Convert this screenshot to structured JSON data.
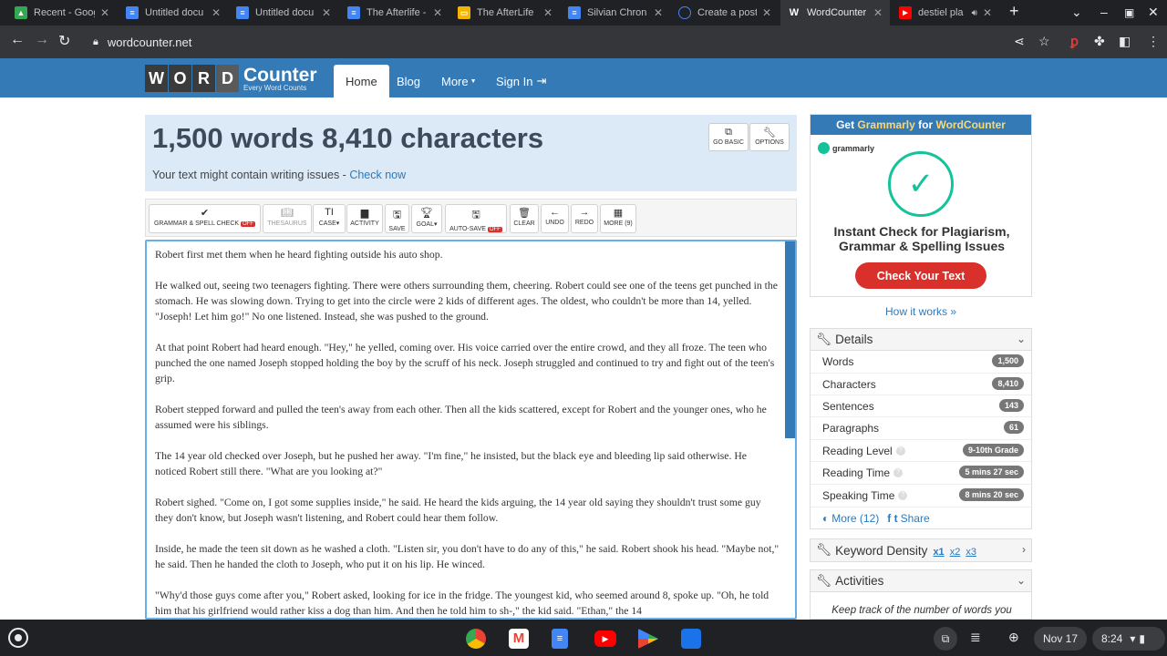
{
  "browser": {
    "tabs": [
      {
        "title": "Recent - Google",
        "icon": "google-drive-icon",
        "color": "#34a853",
        "active": false
      },
      {
        "title": "Untitled docu",
        "icon": "google-docs-icon",
        "color": "#4285f4",
        "active": false
      },
      {
        "title": "Untitled docu",
        "icon": "google-docs-icon",
        "color": "#4285f4",
        "active": false
      },
      {
        "title": "The Afterlife -",
        "icon": "google-docs-icon",
        "color": "#4285f4",
        "active": false
      },
      {
        "title": "The AfterLife",
        "icon": "google-slides-icon",
        "color": "#f4b400",
        "active": false
      },
      {
        "title": "Silvian Chron",
        "icon": "google-docs-icon",
        "color": "#4285f4",
        "active": false
      },
      {
        "title": "Create a post",
        "icon": "blogger-icon",
        "color": "#4285f4",
        "active": false
      },
      {
        "title": "WordCounter",
        "icon": "wordcounter-icon",
        "color": "#35363a",
        "active": true
      },
      {
        "title": "destiel pla",
        "icon": "youtube-icon",
        "color": "#ff0000",
        "active": false
      }
    ],
    "url": "wordcounter.net"
  },
  "site": {
    "logo_letters": [
      "W",
      "O",
      "R",
      "D"
    ],
    "logo_counter": "Counter",
    "logo_tagline": "Every Word Counts",
    "nav": {
      "home": "Home",
      "blog": "Blog",
      "more": "More",
      "signin": "Sign In"
    }
  },
  "main": {
    "word_summary": "1,500 words 8,410 characters",
    "issues_text": "Your text might contain writing issues - ",
    "issues_link": "Check now",
    "go_basic": "GO BASIC",
    "options": "OPTIONS"
  },
  "toolbar": {
    "grammar": "GRAMMAR & SPELL CHECK",
    "off_label": "OFF",
    "thesaurus": "THESAURUS",
    "case": "CASE",
    "activity": "ACTIVITY",
    "save": "SAVE",
    "goal": "GOAL",
    "autosave": "AUTO-SAVE",
    "clear": "CLEAR",
    "undo": "UNDO",
    "redo": "REDO",
    "more": "MORE (9)"
  },
  "editor": {
    "paragraphs": [
      "Robert first met them when he heard fighting outside his auto shop.",
      "He walked out, seeing two teenagers fighting. There were others surrounding them, cheering. Robert could see one of the teens get punched in the stomach. He was slowing down. Trying to get into the circle were 2 kids of different ages. The oldest, who couldn't be more than 14, yelled. \"Joseph! Let him go!\" No one listened. Instead, she was pushed to the ground.",
      "At that point Robert had heard enough. \"Hey,\" he yelled, coming over. His voice carried over the entire crowd, and they all froze. The teen who punched the one named Joseph stopped holding the boy by the scruff of his neck. Joseph struggled and continued to try and fight out of the teen's grip.",
      "Robert stepped forward and pulled the teen's away from each other. Then all the kids scattered, except for Robert and the younger ones, who he assumed were his siblings.",
      "The 14 year old checked over Joseph, but he pushed her away. \"I'm fine,\" he insisted, but the black eye and bleeding lip said otherwise. He noticed Robert still there. \"What are you looking at?\"",
      "Robert sighed. \"Come on, I got some supplies inside,\" he said. He heard the kids arguing, the 14 year old saying they shouldn't trust some guy they don't know, but Joseph wasn't listening, and Robert could hear them follow.",
      "Inside, he made the teen sit down as he washed a cloth. \"Listen sir, you don't have to do any of this,\" he said. Robert shook his head. \"Maybe not,\" he said. Then he handed the cloth to Joseph, who put it on his lip. He winced.",
      "\"Why'd those guys come after you,\" Robert asked, looking for ice in the fridge. The youngest kid, who seemed around 8, spoke up. \"Oh, he told him that his girlfriend would rather kiss a dog than him. And then he told him to sh-,\" the kid said. \"Ethan,\" the 14"
    ]
  },
  "sidebar": {
    "ad_header_prefix": "Get ",
    "ad_header_brand": "Grammarly",
    "ad_header_mid": " for ",
    "ad_header_site": "WordCounter",
    "ad_brand": "grammarly",
    "ad_title": "Instant Check for Plagiarism, Grammar & Spelling Issues",
    "ad_button": "Check Your Text",
    "how_it_works": "How it works »",
    "details_title": "Details",
    "details": [
      {
        "label": "Words",
        "value": "1,500",
        "help": false
      },
      {
        "label": "Characters",
        "value": "8,410",
        "help": false
      },
      {
        "label": "Sentences",
        "value": "143",
        "help": false
      },
      {
        "label": "Paragraphs",
        "value": "61",
        "help": false
      },
      {
        "label": "Reading Level",
        "value": "9-10th Grade",
        "help": true
      },
      {
        "label": "Reading Time",
        "value": "5 mins 27 sec",
        "help": true
      },
      {
        "label": "Speaking Time",
        "value": "8 mins 20 sec",
        "help": true
      }
    ],
    "more_label": "More (12)",
    "share_label": "Share",
    "keyword_title": "Keyword Density",
    "keyword_links": [
      "x1",
      "x2",
      "x3"
    ],
    "activities_title": "Activities",
    "activities_text": "Keep track of the number of words you"
  },
  "shelf": {
    "date": "Nov 17",
    "time": "8:24"
  }
}
